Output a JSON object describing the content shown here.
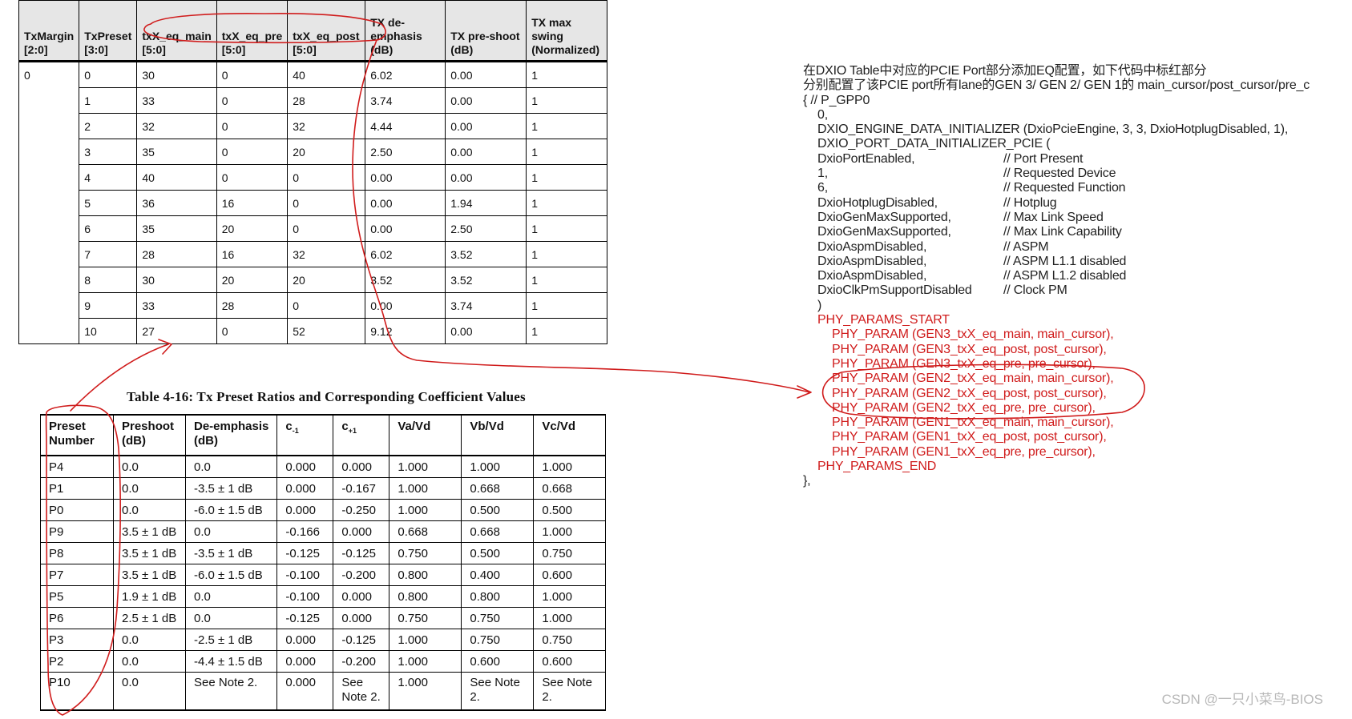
{
  "top_table": {
    "headers": [
      [
        "TxMargin",
        "[2:0]"
      ],
      [
        "TxPreset",
        "[3:0]"
      ],
      [
        "txX_eq_main",
        "[5:0]"
      ],
      [
        "txX_eq_pre",
        "[5:0]"
      ],
      [
        "txX_eq_post",
        "[5:0]"
      ],
      [
        "TX de-",
        "emphasis",
        "(dB)"
      ],
      [
        "TX pre-shoot",
        "(dB)"
      ],
      [
        "TX max",
        "swing",
        "(Normalized)"
      ]
    ],
    "margin_value": "0",
    "rows": [
      [
        "0",
        "30",
        "0",
        "40",
        "6.02",
        "0.00",
        "1"
      ],
      [
        "1",
        "33",
        "0",
        "28",
        "3.74",
        "0.00",
        "1"
      ],
      [
        "2",
        "32",
        "0",
        "32",
        "4.44",
        "0.00",
        "1"
      ],
      [
        "3",
        "35",
        "0",
        "20",
        "2.50",
        "0.00",
        "1"
      ],
      [
        "4",
        "40",
        "0",
        "0",
        "0.00",
        "0.00",
        "1"
      ],
      [
        "5",
        "36",
        "16",
        "0",
        "0.00",
        "1.94",
        "1"
      ],
      [
        "6",
        "35",
        "20",
        "0",
        "0.00",
        "2.50",
        "1"
      ],
      [
        "7",
        "28",
        "16",
        "32",
        "6.02",
        "3.52",
        "1"
      ],
      [
        "8",
        "30",
        "20",
        "20",
        "3.52",
        "3.52",
        "1"
      ],
      [
        "9",
        "33",
        "28",
        "0",
        "0.00",
        "3.74",
        "1"
      ],
      [
        "10",
        "27",
        "0",
        "52",
        "9.12",
        "0.00",
        "1"
      ]
    ]
  },
  "bottom_table": {
    "caption": "Table 4-16:  Tx Preset Ratios and Corresponding Coefficient Values",
    "headers": [
      [
        "Preset",
        "Number"
      ],
      [
        "Preshoot",
        "(dB)"
      ],
      [
        "De-emphasis",
        "(dB)"
      ],
      [
        "c",
        "-1"
      ],
      [
        "c",
        "+1"
      ],
      [
        "Va/Vd"
      ],
      [
        "Vb/Vd"
      ],
      [
        "Vc/Vd"
      ]
    ],
    "rows": [
      [
        "P4",
        "0.0",
        "0.0",
        "0.000",
        "0.000",
        "1.000",
        "1.000",
        "1.000"
      ],
      [
        "P1",
        "0.0",
        "-3.5 ± 1 dB",
        "0.000",
        "-0.167",
        "1.000",
        "0.668",
        "0.668"
      ],
      [
        "P0",
        "0.0",
        "-6.0 ± 1.5 dB",
        "0.000",
        "-0.250",
        "1.000",
        "0.500",
        "0.500"
      ],
      [
        "P9",
        "3.5 ± 1 dB",
        "0.0",
        "-0.166",
        "0.000",
        "0.668",
        "0.668",
        "1.000"
      ],
      [
        "P8",
        "3.5 ± 1 dB",
        "-3.5 ± 1 dB",
        "-0.125",
        "-0.125",
        "0.750",
        "0.500",
        "0.750"
      ],
      [
        "P7",
        "3.5 ± 1 dB",
        "-6.0 ± 1.5 dB",
        "-0.100",
        "-0.200",
        "0.800",
        "0.400",
        "0.600"
      ],
      [
        "P5",
        "1.9 ± 1 dB",
        "0.0",
        "-0.100",
        "0.000",
        "0.800",
        "0.800",
        "1.000"
      ],
      [
        "P6",
        "2.5 ± 1 dB",
        "0.0",
        "-0.125",
        "0.000",
        "0.750",
        "0.750",
        "1.000"
      ],
      [
        "P3",
        "0.0",
        "-2.5 ± 1 dB",
        "0.000",
        "-0.125",
        "1.000",
        "0.750",
        "0.750"
      ],
      [
        "P2",
        "0.0",
        "-4.4 ± 1.5 dB",
        "0.000",
        "-0.200",
        "1.000",
        "0.600",
        "0.600"
      ],
      [
        "P10",
        "0.0",
        "See Note 2.",
        "0.000",
        "See Note 2.",
        "1.000",
        "See Note 2.",
        "See Note 2."
      ]
    ]
  },
  "code": {
    "intro_1": "在DXIO Table中对应的PCIE Port部分添加EQ配置，如下代码中标红部分",
    "intro_2": "分别配置了该PCIE port所有lane的GEN 3/ GEN 2/ GEN 1的 main_cursor/post_cursor/pre_c",
    "lines": [
      {
        "code": "{ // P_GPP0",
        "comment": "",
        "indent": 0,
        "red": false
      },
      {
        "code": "0,",
        "comment": "",
        "indent": 1,
        "red": false
      },
      {
        "code": "DXIO_ENGINE_DATA_INITIALIZER (DxioPcieEngine, 3, 3, DxioHotplugDisabled, 1),",
        "comment": "",
        "indent": 1,
        "red": false
      },
      {
        "code": "DXIO_PORT_DATA_INITIALIZER_PCIE (",
        "comment": "",
        "indent": 1,
        "red": false
      },
      {
        "code": "DxioPortEnabled,",
        "comment": "// Port Present",
        "indent": 1,
        "red": false
      },
      {
        "code": "1,",
        "comment": "// Requested Device",
        "indent": 1,
        "red": false
      },
      {
        "code": "6,",
        "comment": "// Requested Function",
        "indent": 1,
        "red": false
      },
      {
        "code": "DxioHotplugDisabled,",
        "comment": "// Hotplug",
        "indent": 1,
        "red": false
      },
      {
        "code": "DxioGenMaxSupported,",
        "comment": "// Max Link Speed",
        "indent": 1,
        "red": false
      },
      {
        "code": "DxioGenMaxSupported,",
        "comment": "// Max Link Capability",
        "indent": 1,
        "red": false
      },
      {
        "code": "DxioAspmDisabled,",
        "comment": "// ASPM",
        "indent": 1,
        "red": false
      },
      {
        "code": "DxioAspmDisabled,",
        "comment": "// ASPM L1.1 disabled",
        "indent": 1,
        "red": false
      },
      {
        "code": "DxioAspmDisabled,",
        "comment": "// ASPM L1.2 disabled",
        "indent": 1,
        "red": false
      },
      {
        "code": "DxioClkPmSupportDisabled",
        "comment": "// Clock PM",
        "indent": 1,
        "red": false
      },
      {
        "code": ")",
        "comment": "",
        "indent": 1,
        "red": false
      },
      {
        "code": "PHY_PARAMS_START",
        "comment": "",
        "indent": 1,
        "red": true
      },
      {
        "code": "PHY_PARAM (GEN3_txX_eq_main, main_cursor),",
        "comment": "",
        "indent": 2,
        "red": true
      },
      {
        "code": "PHY_PARAM (GEN3_txX_eq_post, post_cursor),",
        "comment": "",
        "indent": 2,
        "red": true
      },
      {
        "code": "PHY_PARAM (GEN3_txX_eq_pre, pre_cursor),",
        "comment": "",
        "indent": 2,
        "red": true
      },
      {
        "code": "PHY_PARAM (GEN2_txX_eq_main, main_cursor),",
        "comment": "",
        "indent": 2,
        "red": true
      },
      {
        "code": "PHY_PARAM (GEN2_txX_eq_post, post_cursor),",
        "comment": "",
        "indent": 2,
        "red": true
      },
      {
        "code": "PHY_PARAM (GEN2_txX_eq_pre, pre_cursor),",
        "comment": "",
        "indent": 2,
        "red": true
      },
      {
        "code": "PHY_PARAM (GEN1_txX_eq_main, main_cursor),",
        "comment": "",
        "indent": 2,
        "red": true
      },
      {
        "code": "PHY_PARAM (GEN1_txX_eq_post, post_cursor),",
        "comment": "",
        "indent": 2,
        "red": true
      },
      {
        "code": "PHY_PARAM (GEN1_txX_eq_pre, pre_cursor),",
        "comment": "",
        "indent": 2,
        "red": true
      },
      {
        "code": "PHY_PARAMS_END",
        "comment": "",
        "indent": 1,
        "red": true
      },
      {
        "code": "},",
        "comment": "",
        "indent": 0,
        "red": false
      }
    ]
  },
  "watermark": "CSDN @一只小菜鸟-BIOS",
  "colors": {
    "annotation_red": "#d01c1c",
    "header_gray": "#e6e6e6",
    "watermark_gray": "#b8b8b8"
  }
}
